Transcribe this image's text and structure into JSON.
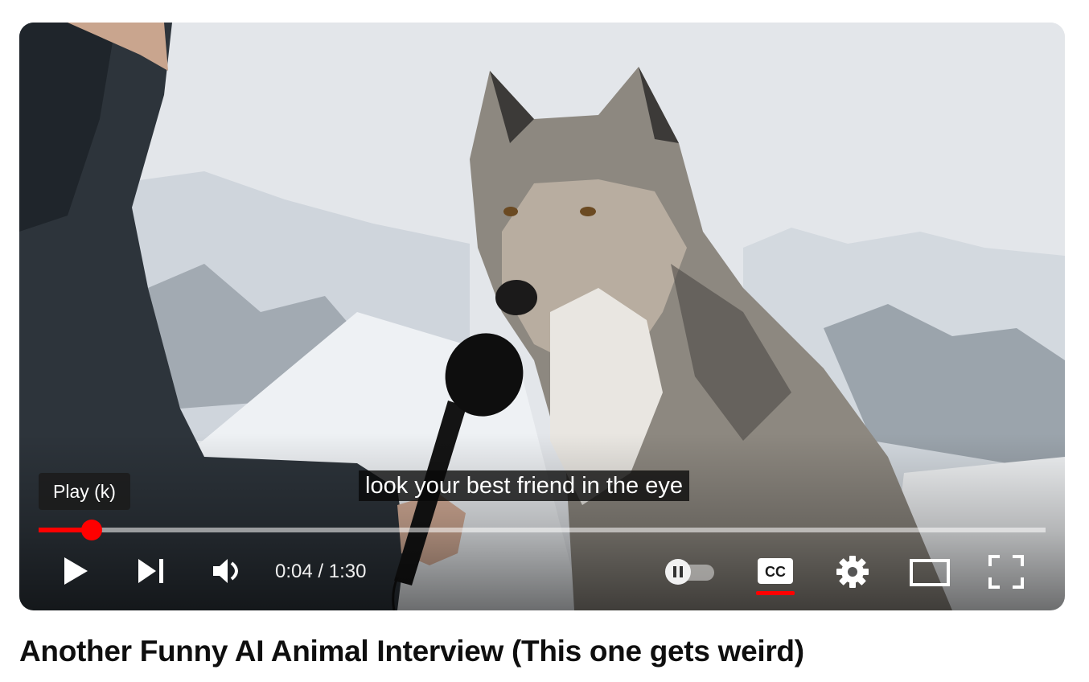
{
  "player": {
    "tooltip": "Play (k)",
    "caption": "look your best friend in the eye",
    "time": {
      "current": "0:04",
      "separator": " / ",
      "duration": "1:30"
    },
    "progress_fraction": 0.053,
    "accent_color": "#ff0000",
    "controls": {
      "play": "play-icon",
      "next": "skip-next-icon",
      "volume": "volume-icon",
      "autoplay": "autoplay-toggle-icon",
      "captions": "closed-captions-icon",
      "settings": "gear-icon",
      "theater": "theater-mode-icon",
      "fullscreen": "fullscreen-icon"
    }
  },
  "video": {
    "title": "Another Funny AI Animal Interview (This one gets weird)"
  }
}
